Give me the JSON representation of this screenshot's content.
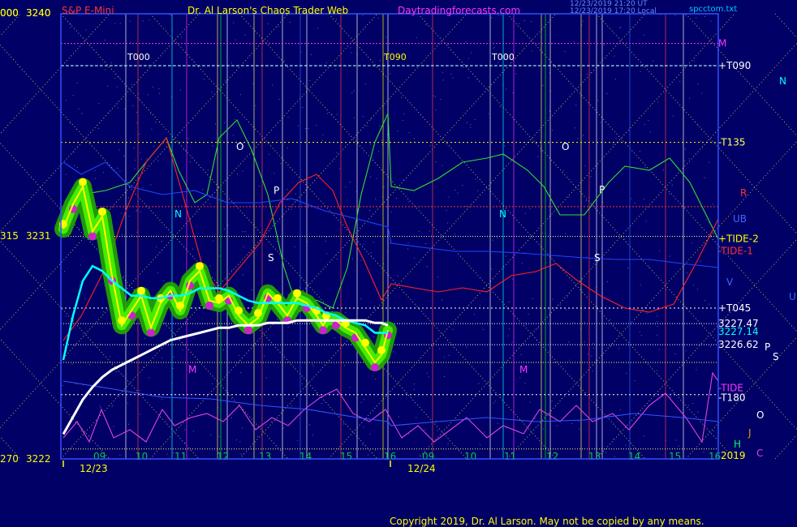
{
  "header": {
    "left_price_code": "000",
    "left_price": "3240",
    "symbol": "S&P E-Mini",
    "title": "Dr. Al Larson's Chaos Trader Web",
    "site": "Daytradingforecasts.com",
    "timestamp_1": "12/23/2019 21:20 UT",
    "timestamp_2": "12/23/2019 17:20 Local",
    "file": "spcctom.txt"
  },
  "footer": {
    "copyright": "Copyright 2019, Dr. Al Larson. May not be copied by any means."
  },
  "chart_data": {
    "type": "line",
    "title": "S&P E-Mini",
    "ylim": [
      3222,
      3240
    ],
    "left_axis_labels": [
      {
        "code": "000",
        "price": "3240"
      },
      {
        "code": "315",
        "price": "3231"
      },
      {
        "code": "270",
        "price": "3222"
      }
    ],
    "x_tick_labels": [
      "09",
      "10",
      "11",
      "12",
      "13",
      "14",
      "15",
      "16",
      "09",
      "10",
      "11",
      "12",
      "13",
      "14",
      "15",
      "16"
    ],
    "date_labels": [
      "12/23",
      "12/24"
    ],
    "year_label": "2019",
    "right_labels": [
      {
        "text": "M",
        "price": 3238.8
      },
      {
        "text": "+T090",
        "price": 3237.9
      },
      {
        "text": "-T135",
        "price": 3234.8
      },
      {
        "text": "+TIDE-2",
        "price": 3230.9
      },
      {
        "text": "-TIDE-1",
        "price": 3230.6
      },
      {
        "text": "+T045",
        "price": 3228.1
      },
      {
        "text": "3227.47",
        "price": 3227.47
      },
      {
        "text": "3227.14",
        "price": 3227.14
      },
      {
        "text": "3226.62",
        "price": 3226.62
      },
      {
        "text": "-TIDE",
        "price": 3224.7
      },
      {
        "text": "-T180",
        "price": 3224.6
      }
    ],
    "right_planet_labels": [
      "N",
      "R",
      "UB",
      "V",
      "U",
      "P",
      "S",
      "O",
      "J",
      "H",
      "C"
    ],
    "top_markers": [
      "T000",
      "T090",
      "T000"
    ],
    "plot_markers": [
      "O",
      "P",
      "N",
      "S",
      "M",
      "O",
      "P",
      "N",
      "S",
      "M"
    ],
    "series": [
      {
        "name": "price",
        "color": "#ffff00",
        "x": [
          0,
          3,
          6,
          9,
          12,
          15,
          18,
          21,
          24,
          27,
          30,
          33,
          36,
          39,
          42,
          45,
          48,
          51,
          54,
          57,
          60,
          63,
          66,
          69,
          72,
          75,
          78,
          80,
          81,
          84,
          87,
          90,
          93,
          96,
          98,
          100
        ],
        "values": [
          3231.3,
          3232.3,
          3233.0,
          3231.2,
          3231.8,
          3229.4,
          3227.4,
          3228.0,
          3228.6,
          3227.3,
          3228.3,
          3228.8,
          3228.0,
          3229.2,
          3229.6,
          3228.4,
          3228.3,
          3228.6,
          3227.8,
          3227.4,
          3227.7,
          3228.7,
          3228.3,
          3227.8,
          3228.5,
          3228.3,
          3227.8,
          3227.4,
          3227.6,
          3227.6,
          3227.3,
          3227.1,
          3226.5,
          3225.9,
          3226.2,
          3227.2
        ]
      },
      {
        "name": "cyan average",
        "color": "#00ffff",
        "x": [
          0,
          3,
          6,
          9,
          12,
          15,
          18,
          21,
          24,
          27,
          30,
          33,
          36,
          39,
          42,
          45,
          48,
          51,
          54,
          57,
          60,
          63,
          66,
          69,
          72,
          75,
          78,
          81,
          84,
          87,
          90,
          93,
          96,
          98,
          100
        ],
        "values": [
          3226.0,
          3227.8,
          3229.2,
          3229.8,
          3229.6,
          3229.2,
          3228.9,
          3228.6,
          3228.6,
          3228.5,
          3228.5,
          3228.6,
          3228.6,
          3228.7,
          3228.9,
          3228.9,
          3228.9,
          3228.8,
          3228.6,
          3228.4,
          3228.3,
          3228.3,
          3228.3,
          3228.3,
          3228.3,
          3228.2,
          3228.1,
          3227.9,
          3227.8,
          3227.6,
          3227.5,
          3227.4,
          3227.1,
          3227.1,
          3227.1
        ]
      },
      {
        "name": "white average",
        "color": "#ffffff",
        "x": [
          0,
          3,
          6,
          9,
          12,
          15,
          18,
          21,
          24,
          27,
          30,
          33,
          36,
          39,
          42,
          45,
          48,
          51,
          54,
          57,
          60,
          63,
          66,
          69,
          72,
          75,
          78,
          81,
          84,
          87,
          90,
          93,
          96,
          98,
          100
        ],
        "values": [
          3223.0,
          3223.7,
          3224.4,
          3224.9,
          3225.3,
          3225.6,
          3225.8,
          3226.0,
          3226.2,
          3226.4,
          3226.6,
          3226.8,
          3226.9,
          3227.0,
          3227.1,
          3227.2,
          3227.3,
          3227.3,
          3227.4,
          3227.4,
          3227.4,
          3227.5,
          3227.5,
          3227.5,
          3227.6,
          3227.6,
          3227.6,
          3227.6,
          3227.6,
          3227.6,
          3227.6,
          3227.6,
          3227.5,
          3227.5,
          3227.4
        ]
      }
    ]
  }
}
